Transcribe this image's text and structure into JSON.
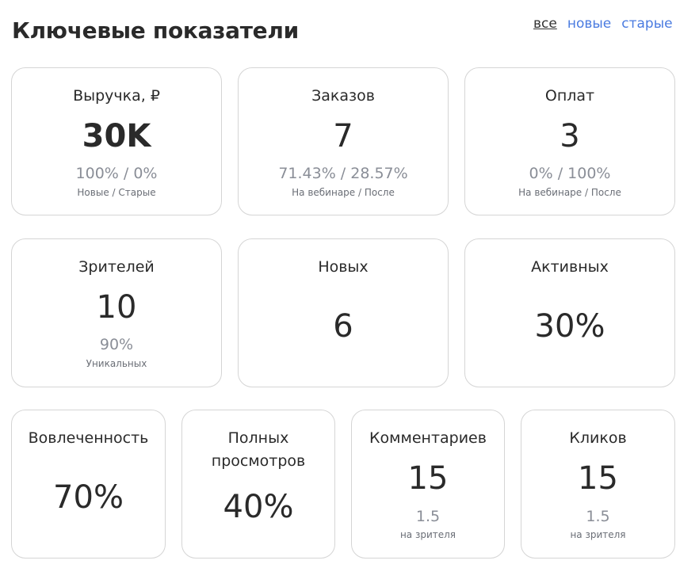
{
  "header": {
    "title": "Ключевые показатели",
    "filters": [
      "все",
      "новые",
      "старые"
    ],
    "active_filter": "все"
  },
  "cards": {
    "revenue": {
      "label": "Выручка, ₽",
      "value": "30K",
      "sub": "100% / 0%",
      "note": "Новые / Старые"
    },
    "orders": {
      "label": "Заказов",
      "value": "7",
      "sub": "71.43% / 28.57%",
      "note": "На вебинаре / После"
    },
    "payments": {
      "label": "Оплат",
      "value": "3",
      "sub": "0% / 100%",
      "note": "На вебинаре / После"
    },
    "viewers": {
      "label": "Зрителей",
      "value": "10",
      "sub": "90%",
      "note": "Уникальных"
    },
    "new": {
      "label": "Новых",
      "value": "6"
    },
    "active": {
      "label": "Активных",
      "value": "30%"
    },
    "engagement": {
      "label": "Вовлеченность",
      "value": "70%"
    },
    "full_views": {
      "label_line1": "Полных",
      "label_line2": "просмотров",
      "value": "40%"
    },
    "comments": {
      "label": "Комментариев",
      "value": "15",
      "sub": "1.5",
      "note": "на зрителя"
    },
    "clicks": {
      "label": "Кликов",
      "value": "15",
      "sub": "1.5",
      "note": "на зрителя"
    }
  }
}
